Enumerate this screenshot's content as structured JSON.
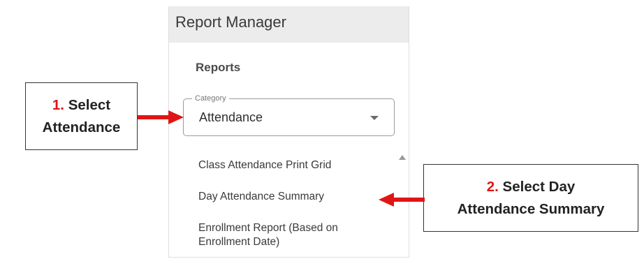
{
  "panel": {
    "title": "Report Manager",
    "section_heading": "Reports",
    "category": {
      "legend": "Category",
      "value": "Attendance"
    },
    "reports": [
      {
        "label": "Class Attendance Print Grid"
      },
      {
        "label": "Day Attendance Summary"
      },
      {
        "label": "Enrollment Report (Based on Enrollment Date)"
      }
    ]
  },
  "callouts": {
    "step1": {
      "number": "1.",
      "line1": "Select",
      "line2": "Attendance"
    },
    "step2": {
      "number": "2.",
      "line1": "Select Day",
      "line2": "Attendance Summary"
    }
  },
  "colors": {
    "step_number": "#e01515",
    "arrow": "#e01515",
    "header_bg": "#ececec"
  }
}
